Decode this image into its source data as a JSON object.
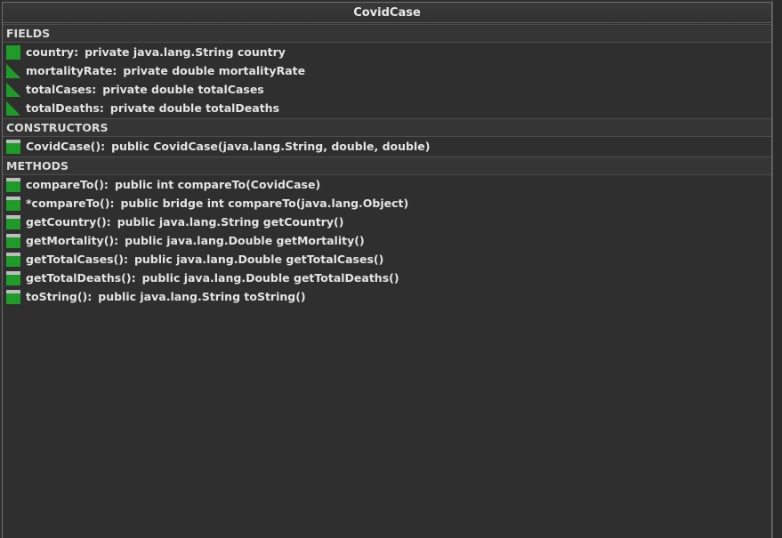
{
  "window": {
    "title": "CovidCase"
  },
  "sections": {
    "fields": {
      "label": "FIELDS",
      "items": [
        {
          "name": "country:",
          "sig": "private java.lang.String country",
          "icon": "field-public-square-icon"
        },
        {
          "name": "mortalityRate:",
          "sig": "private double mortalityRate",
          "icon": "field-private-triangle-icon"
        },
        {
          "name": "totalCases:",
          "sig": "private double totalCases",
          "icon": "field-private-triangle-icon"
        },
        {
          "name": "totalDeaths:",
          "sig": "private double totalDeaths",
          "icon": "field-private-triangle-icon"
        }
      ]
    },
    "constructors": {
      "label": "CONSTRUCTORS",
      "items": [
        {
          "name": "CovidCase():",
          "sig": "public CovidCase(java.lang.String, double, double)",
          "icon": "constructor-icon"
        }
      ]
    },
    "methods": {
      "label": "METHODS",
      "items": [
        {
          "name": "compareTo():",
          "sig": "public int compareTo(CovidCase)",
          "icon": "method-icon"
        },
        {
          "name": "*compareTo():",
          "sig": "public bridge int compareTo(java.lang.Object)",
          "icon": "method-icon"
        },
        {
          "name": "getCountry():",
          "sig": "public java.lang.String getCountry()",
          "icon": "method-icon"
        },
        {
          "name": "getMortality():",
          "sig": "public java.lang.Double getMortality()",
          "icon": "method-icon"
        },
        {
          "name": "getTotalCases():",
          "sig": "public java.lang.Double getTotalCases()",
          "icon": "method-icon"
        },
        {
          "name": "getTotalDeaths():",
          "sig": "public java.lang.Double getTotalDeaths()",
          "icon": "method-icon"
        },
        {
          "name": "toString():",
          "sig": "public java.lang.String toString()",
          "icon": "method-icon"
        }
      ]
    }
  },
  "colors": {
    "background": "#2f2f2f",
    "icon_green": "#1f9b2a",
    "icon_gray": "#bdbdbd",
    "text": "#e4e4e4"
  }
}
